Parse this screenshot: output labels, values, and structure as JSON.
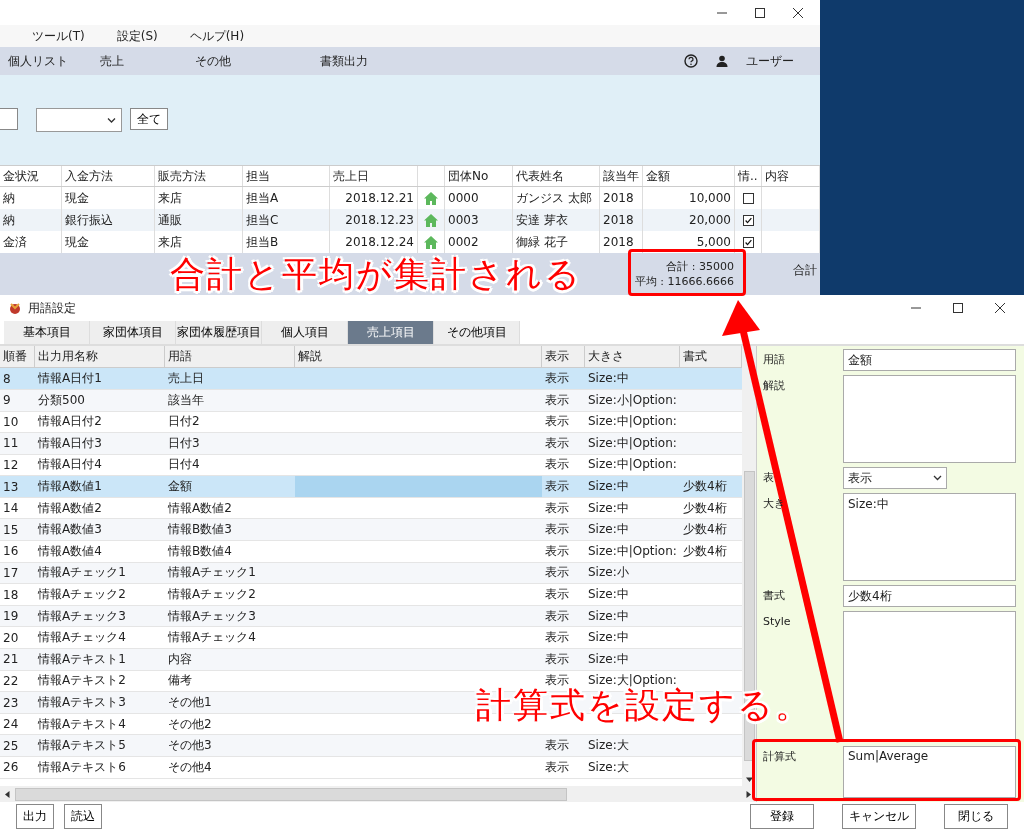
{
  "main_window": {
    "menu": [
      "ツール(T)",
      "設定(S)",
      "ヘルプ(H)"
    ],
    "nav": [
      "個人リスト",
      "売上",
      "その他",
      "書類出力"
    ],
    "user": "ユーザー",
    "filter_button": "全て",
    "table": {
      "columns": [
        "金状況",
        "入金方法",
        "販売方法",
        "担当",
        "売上日",
        "",
        "団体No",
        "代表姓名",
        "該当年",
        "金額",
        "情..",
        "内容"
      ],
      "rows": [
        {
          "cells": [
            "納",
            "現金",
            "来店",
            "担当A",
            "2018.12.21",
            "",
            "0000",
            "ガンジス 太郎",
            "2018",
            "10,000"
          ],
          "checked": false
        },
        {
          "cells": [
            "納",
            "銀行振込",
            "通販",
            "担当C",
            "2018.12.23",
            "",
            "0003",
            "安達 芽衣",
            "2018",
            "20,000"
          ],
          "checked": true
        },
        {
          "cells": [
            "金済",
            "現金",
            "来店",
            "担当B",
            "2018.12.24",
            "",
            "0002",
            "御緑 花子",
            "2018",
            "5,000"
          ],
          "checked": true
        }
      ]
    },
    "totals": [
      "合計 : 35000",
      "平均 : 11666.6666"
    ],
    "totals_cut": "合計"
  },
  "dialog": {
    "title": "用語設定",
    "tabs": [
      {
        "label": "基本項目",
        "selected": false
      },
      {
        "label": "家団体項目",
        "selected": false
      },
      {
        "label": "家団体履歴項目",
        "selected": false
      },
      {
        "label": "個人項目",
        "selected": false
      },
      {
        "label": "売上項目",
        "selected": true
      },
      {
        "label": "その他項目",
        "selected": false
      }
    ],
    "table": {
      "columns": [
        "順番",
        "出力用名称",
        "用語",
        "解説",
        "表示",
        "大きさ",
        "書式"
      ],
      "rows": [
        {
          "order": "8",
          "output_name": "情報A日付1",
          "term": "売上日",
          "display": "表示",
          "size": "Size:中",
          "selected": true,
          "focused": false
        },
        {
          "order": "9",
          "output_name": "分類500",
          "term": "該当年",
          "display": "表示",
          "size": "Size:小|Option:",
          "selected": false,
          "focused": false
        },
        {
          "order": "10",
          "output_name": "情報A日付2",
          "term": "日付2",
          "display": "表示",
          "size": "Size:中|Option:",
          "selected": false,
          "focused": false
        },
        {
          "order": "11",
          "output_name": "情報A日付3",
          "term": "日付3",
          "display": "表示",
          "size": "Size:中|Option:",
          "selected": false,
          "focused": false
        },
        {
          "order": "12",
          "output_name": "情報A日付4",
          "term": "日付4",
          "display": "表示",
          "size": "Size:中|Option:",
          "selected": false,
          "focused": false
        },
        {
          "order": "13",
          "output_name": "情報A数値1",
          "term": "金額",
          "display": "表示",
          "size": "Size:中",
          "format": "少数4桁",
          "selected": true,
          "focused": true
        },
        {
          "order": "14",
          "output_name": "情報A数値2",
          "term": "情報A数値2",
          "display": "表示",
          "size": "Size:中",
          "format": "少数4桁",
          "selected": false,
          "focused": false
        },
        {
          "order": "15",
          "output_name": "情報A数値3",
          "term": "情報B数値3",
          "display": "表示",
          "size": "Size:中",
          "format": "少数4桁",
          "selected": false,
          "focused": false
        },
        {
          "order": "16",
          "output_name": "情報A数値4",
          "term": "情報B数値4",
          "display": "表示",
          "size": "Size:中|Option:",
          "format": "少数4桁",
          "selected": false,
          "focused": false
        },
        {
          "order": "17",
          "output_name": "情報Aチェック1",
          "term": "情報Aチェック1",
          "display": "表示",
          "size": "Size:小",
          "selected": false,
          "focused": false
        },
        {
          "order": "18",
          "output_name": "情報Aチェック2",
          "term": "情報Aチェック2",
          "display": "表示",
          "size": "Size:中",
          "selected": false,
          "focused": false
        },
        {
          "order": "19",
          "output_name": "情報Aチェック3",
          "term": "情報Aチェック3",
          "display": "表示",
          "size": "Size:中",
          "selected": false,
          "focused": false
        },
        {
          "order": "20",
          "output_name": "情報Aチェック4",
          "term": "情報Aチェック4",
          "display": "表示",
          "size": "Size:中",
          "selected": false,
          "focused": false
        },
        {
          "order": "21",
          "output_name": "情報Aテキスト1",
          "term": "内容",
          "display": "表示",
          "size": "Size:中",
          "selected": false,
          "focused": false
        },
        {
          "order": "22",
          "output_name": "情報Aテキスト2",
          "term": "備考",
          "display": "表示",
          "size": "Size:大|Option:",
          "selected": false,
          "focused": false
        },
        {
          "order": "23",
          "output_name": "情報Aテキスト3",
          "term": "その他1",
          "selected": false,
          "focused": false
        },
        {
          "order": "24",
          "output_name": "情報Aテキスト4",
          "term": "その他2",
          "selected": false,
          "focused": false
        },
        {
          "order": "25",
          "output_name": "情報Aテキスト5",
          "term": "その他3",
          "display": "表示",
          "size": "Size:大",
          "selected": false,
          "focused": false
        },
        {
          "order": "26",
          "output_name": "情報Aテキスト6",
          "term": "その他4",
          "display": "表示",
          "size": "Size:大",
          "selected": false,
          "focused": false
        }
      ]
    },
    "form": [
      {
        "label": "用語",
        "kind": "input",
        "value": "金額"
      },
      {
        "label": "解説",
        "kind": "textarea"
      },
      {
        "label": "表",
        "kind": "select",
        "value": "表示"
      },
      {
        "label": "大き",
        "kind": "textarea",
        "value": "Size:中"
      },
      {
        "label": "書式",
        "kind": "input",
        "value": "少数4桁"
      },
      {
        "label": "Style",
        "kind": "textarea"
      },
      {
        "label": "計算式",
        "kind": "textarea",
        "value": "Sum|Average"
      }
    ],
    "left_buttons": [
      "出力",
      "読込"
    ],
    "right_buttons": [
      "登録",
      "キャンセル",
      "閉じる"
    ]
  },
  "annotations": [
    {
      "text": "合計と平均が集計される"
    },
    {
      "text": "計算式を設定する。"
    }
  ]
}
